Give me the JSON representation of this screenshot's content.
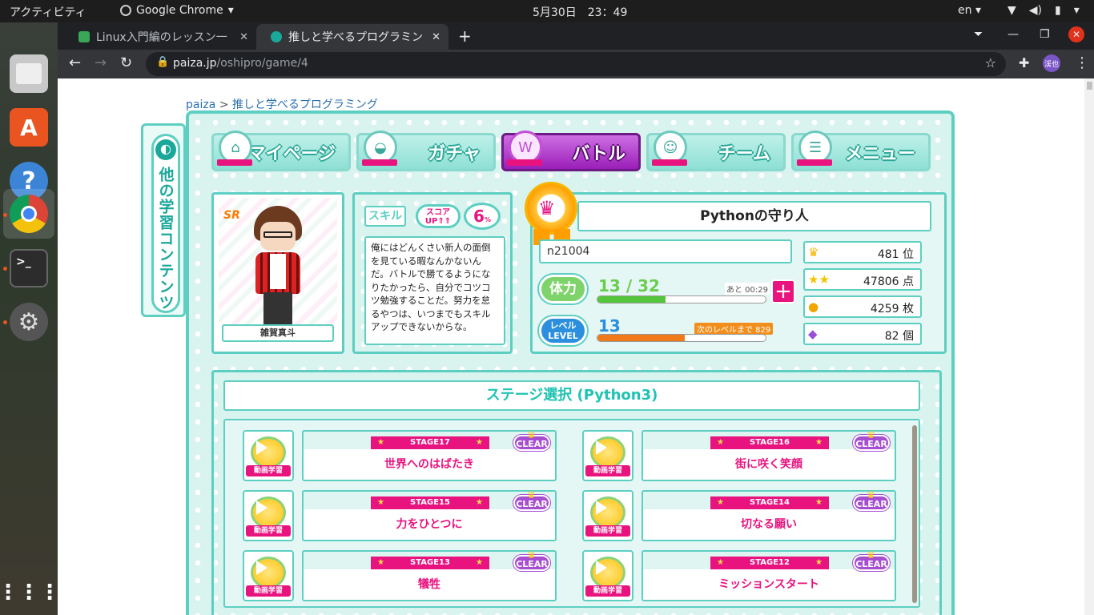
{
  "os": {
    "activities": "アクティビティ",
    "app_name": "Google Chrome",
    "clock": "5月30日　23：49",
    "lang": "en"
  },
  "browser": {
    "tabs": [
      {
        "label": "Linux入門編のレッスン一"
      },
      {
        "label": "推しと学べるプログラミン"
      }
    ],
    "url_host": "paiza.jp",
    "url_path": "/oshipro/game/4",
    "profile": "渓也"
  },
  "breadcrumb": {
    "home": "paiza",
    "sep": ">",
    "current": "推しと学べるプログラミング"
  },
  "side_tab": {
    "label": "他の学習コンテンツ"
  },
  "nav": [
    {
      "label": "マイページ",
      "icon": "home-icon"
    },
    {
      "label": "ガチャ",
      "icon": "capsule-icon"
    },
    {
      "label": "バトル",
      "icon": "battle-icon"
    },
    {
      "label": "チーム",
      "icon": "team-icon"
    },
    {
      "label": "メニュー",
      "icon": "menu-list-icon"
    }
  ],
  "character": {
    "rarity": "SR",
    "name": "雑賀真斗"
  },
  "skill": {
    "tag": "スキル",
    "up_line1": "スコア",
    "up_line2": "UP⇑⇑",
    "percent": "6",
    "pct_sign": "%",
    "text": "俺にはどんくさい新人の面倒を見ている暇なんかないんだ。バトルで勝てるようになりたかったら、自分でコツコツ勉強することだ。努力を怠るやつは、いつまでもスキルアップできないからな。"
  },
  "profile": {
    "title": "Pythonの守り人",
    "user_id": "n21004",
    "hp_label": "体力",
    "hp_current": "13",
    "hp_sep": "/",
    "hp_max": "32",
    "hp_fraction": 0.40625,
    "hp_timer": "あと 00:29",
    "level_label_1": "レベル",
    "level_label_2": "LEVEL",
    "level": "13",
    "next_level": "次のレベルまで 829",
    "xp_fraction": 0.52,
    "rank": "481 位",
    "score": "47806 点",
    "coins": "4259 枚",
    "gems": "82 個"
  },
  "stages": {
    "title": "ステージ選択 (Python3)",
    "video_label": "動画学習",
    "clear_label": "CLEAR",
    "items": [
      {
        "num": "STAGE17",
        "name": "世界へのはばたき"
      },
      {
        "num": "STAGE16",
        "name": "街に咲く笑顔"
      },
      {
        "num": "STAGE15",
        "name": "力をひとつに"
      },
      {
        "num": "STAGE14",
        "name": "切なる願い"
      },
      {
        "num": "STAGE13",
        "name": "犠牲"
      },
      {
        "num": "STAGE12",
        "name": "ミッションスタート"
      }
    ]
  }
}
